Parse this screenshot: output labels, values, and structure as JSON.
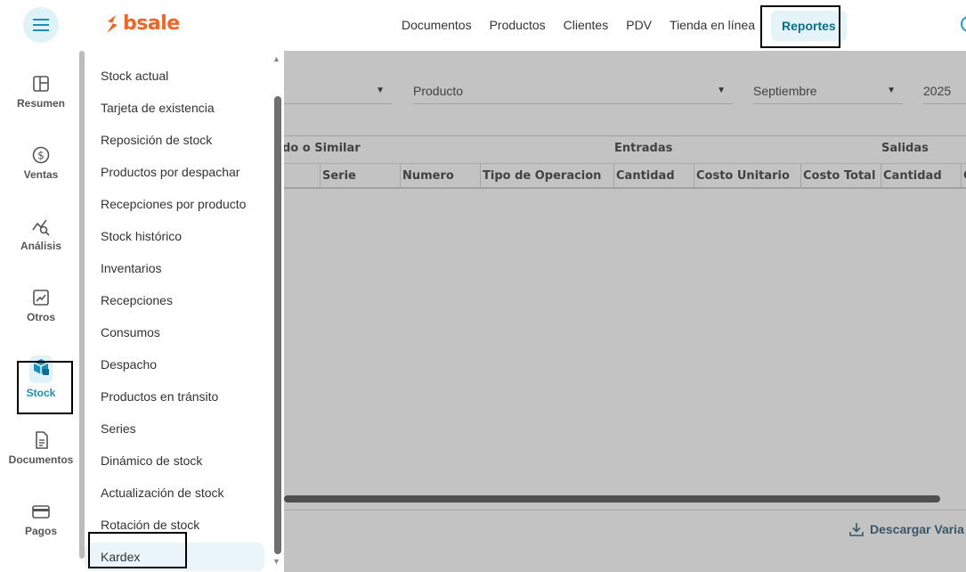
{
  "topbar": {
    "logo_text": "bsale",
    "nav": [
      "Documentos",
      "Productos",
      "Clientes",
      "PDV",
      "Tienda en línea"
    ],
    "nav_active": "Reportes"
  },
  "sidebar": {
    "items": [
      {
        "label": "Resumen",
        "icon": "layout-icon"
      },
      {
        "label": "Ventas",
        "icon": "dollar-icon"
      },
      {
        "label": "Análisis",
        "icon": "analytics-icon"
      },
      {
        "label": "Otros",
        "icon": "chart-up-icon"
      },
      {
        "label": "Stock",
        "icon": "box-icon"
      },
      {
        "label": "Documentos",
        "icon": "document-icon"
      },
      {
        "label": "Pagos",
        "icon": "card-icon"
      }
    ],
    "active": "Stock"
  },
  "menu": {
    "items": [
      "Stock actual",
      "Tarjeta de existencia",
      "Reposición de stock",
      "Productos por despachar",
      "Recepciones por producto",
      "Stock histórico",
      "Inventarios",
      "Recepciones",
      "Consumos",
      "Despacho",
      "Productos en tránsito",
      "Series",
      "Dinámico de stock",
      "Actualización de stock",
      "Rotación de stock",
      "Kardex"
    ],
    "active": "Kardex"
  },
  "filters": {
    "producto_placeholder": "Producto",
    "month": "Septiembre",
    "year": "2025"
  },
  "table": {
    "group_headers": [
      "do o Similar",
      "Entradas",
      "Salidas"
    ],
    "columns": [
      "Serie",
      "Numero",
      "Tipo de Operacion",
      "Cantidad",
      "Costo Unitario",
      "Costo Total",
      "Cantidad",
      "C"
    ]
  },
  "footer": {
    "download_label": "Descargar Varia"
  },
  "colors": {
    "brand": "#f26522",
    "accent": "#1a8fbf",
    "nav_active": "#0a6e8c"
  }
}
